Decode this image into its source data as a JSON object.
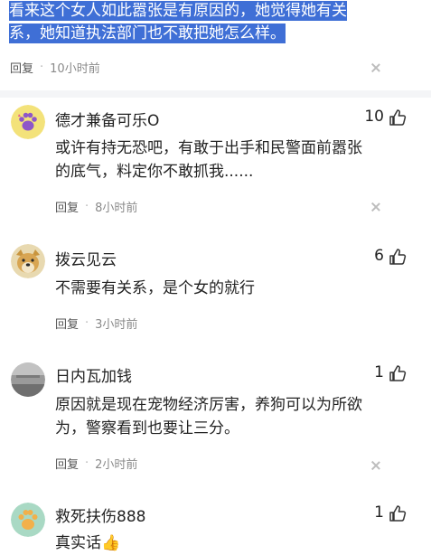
{
  "top_comment": {
    "text_line1": "看来这个女人如此嚣张是有原因的，她觉得她有关",
    "text_line2": "系，她知道执法部门也不敢把她怎么样。",
    "reply_label": "回复",
    "time": "10小时前"
  },
  "comments": [
    {
      "username": "德才兼备可乐O",
      "likes": "10",
      "text_line1": "或许有持无恐吧，有敢于出手和民警面前嚣张",
      "text_line2": "的底气，料定你不敢抓我......",
      "reply_label": "回复",
      "time": "8小时前",
      "avatar_icon": "paw-avatar-icon"
    },
    {
      "username": "拨云见云",
      "likes": "6",
      "text_line1": "不需要有关系，是个女的就行",
      "reply_label": "回复",
      "time": "3小时前",
      "avatar_icon": "dog-avatar-icon"
    },
    {
      "username": "日内瓦加钱",
      "likes": "1",
      "text_line1": "原因就是现在宠物经济厉害，养狗可以为所欲",
      "text_line2": "为，警察看到也要让三分。",
      "reply_label": "回复",
      "time": "2小时前",
      "avatar_icon": "gray-avatar-icon"
    },
    {
      "username": "救死扶伤888",
      "likes": "1",
      "text_line1": "真实话👍",
      "avatar_icon": "paw-avatar-icon"
    }
  ],
  "icons": {
    "like": "thumbs-up-icon",
    "close": "close-icon"
  },
  "colors": {
    "selection": "#3f6fd6",
    "divider": "#f4f5f7",
    "meta_text": "#8a8a8a"
  }
}
